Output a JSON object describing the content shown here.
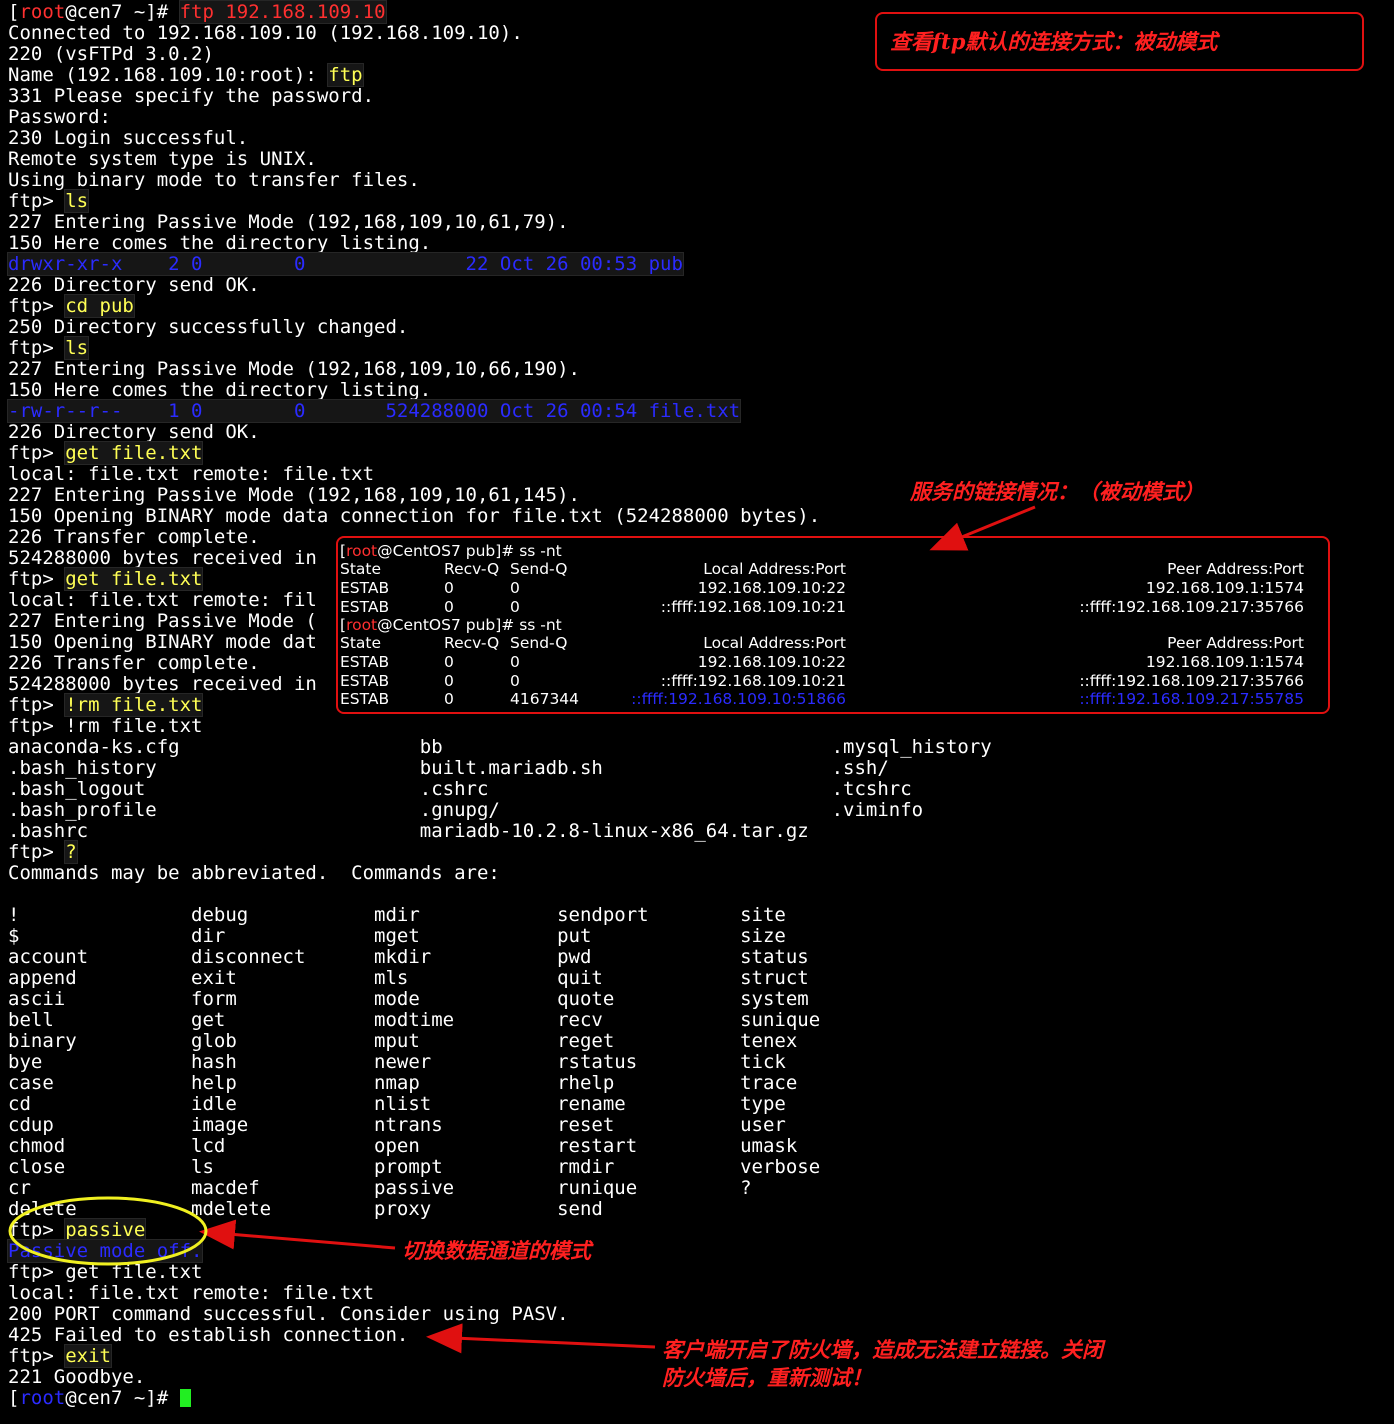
{
  "terminal": {
    "lines": [
      {
        "segments": [
          {
            "t": "[",
            "c": "w"
          },
          {
            "t": "root",
            "c": "r"
          },
          {
            "t": "@cen7 ~]# ",
            "c": "w"
          },
          {
            "t": "ftp 192.168.109.10",
            "c": "r",
            "hl": true
          }
        ]
      },
      {
        "segments": [
          {
            "t": "Connected to 192.168.109.10 (192.168.109.10).",
            "c": "w"
          }
        ]
      },
      {
        "segments": [
          {
            "t": "220 (vsFTPd 3.0.2)",
            "c": "w"
          }
        ]
      },
      {
        "segments": [
          {
            "t": "Name (192.168.109.10:root): ",
            "c": "w"
          },
          {
            "t": "ftp",
            "c": "y",
            "hl": true
          }
        ]
      },
      {
        "segments": [
          {
            "t": "331 Please specify the password.",
            "c": "w"
          }
        ]
      },
      {
        "segments": [
          {
            "t": "Password:",
            "c": "w"
          }
        ]
      },
      {
        "segments": [
          {
            "t": "230 Login successful.",
            "c": "w"
          }
        ]
      },
      {
        "segments": [
          {
            "t": "Remote system type is UNIX.",
            "c": "w"
          }
        ]
      },
      {
        "segments": [
          {
            "t": "Using binary mode to transfer files.",
            "c": "w"
          }
        ]
      },
      {
        "segments": [
          {
            "t": "ftp> ",
            "c": "w"
          },
          {
            "t": "ls",
            "c": "y",
            "hl": true
          }
        ]
      },
      {
        "segments": [
          {
            "t": "227 Entering Passive Mode (192,168,109,10,61,79).",
            "c": "w"
          }
        ]
      },
      {
        "segments": [
          {
            "t": "150 Here comes the directory listing.",
            "c": "w"
          }
        ]
      },
      {
        "segments": [
          {
            "t": "drwxr-xr-x    2 0        0              22 Oct 26 00:53 pub",
            "c": "b",
            "hl": true
          }
        ]
      },
      {
        "segments": [
          {
            "t": "226 Directory send OK.",
            "c": "w"
          }
        ]
      },
      {
        "segments": [
          {
            "t": "ftp> ",
            "c": "w"
          },
          {
            "t": "cd pub",
            "c": "y",
            "hl": true
          }
        ]
      },
      {
        "segments": [
          {
            "t": "250 Directory successfully changed.",
            "c": "w"
          }
        ]
      },
      {
        "segments": [
          {
            "t": "ftp> ",
            "c": "w"
          },
          {
            "t": "ls",
            "c": "y",
            "hl": true
          }
        ]
      },
      {
        "segments": [
          {
            "t": "227 Entering Passive Mode (192,168,109,10,66,190).",
            "c": "w"
          }
        ]
      },
      {
        "segments": [
          {
            "t": "150 Here comes the directory listing.",
            "c": "w"
          }
        ]
      },
      {
        "segments": [
          {
            "t": "-rw-r--r--    1 0        0       524288000 Oct 26 00:54 file.txt",
            "c": "b",
            "hl": true
          }
        ]
      },
      {
        "segments": [
          {
            "t": "226 Directory send OK.",
            "c": "w"
          }
        ]
      },
      {
        "segments": [
          {
            "t": "ftp> ",
            "c": "w"
          },
          {
            "t": "get file.txt",
            "c": "y",
            "hl": true
          }
        ]
      },
      {
        "segments": [
          {
            "t": "local: file.txt remote: file.txt",
            "c": "w"
          }
        ]
      },
      {
        "segments": [
          {
            "t": "227 Entering Passive Mode (192,168,109,10,61,145).",
            "c": "w"
          }
        ]
      },
      {
        "segments": [
          {
            "t": "150 Opening BINARY mode data connection for file.txt (524288000 bytes).",
            "c": "w"
          }
        ]
      },
      {
        "segments": [
          {
            "t": "226 Transfer complete.",
            "c": "w"
          }
        ]
      },
      {
        "segments": [
          {
            "t": "524288000 bytes received in",
            "c": "w"
          }
        ]
      },
      {
        "segments": [
          {
            "t": "ftp> ",
            "c": "w"
          },
          {
            "t": "get file.txt",
            "c": "y",
            "hl": true
          }
        ]
      },
      {
        "segments": [
          {
            "t": "local: file.txt remote: fil",
            "c": "w"
          }
        ]
      },
      {
        "segments": [
          {
            "t": "227 Entering Passive Mode (",
            "c": "w"
          }
        ]
      },
      {
        "segments": [
          {
            "t": "150 Opening BINARY mode dat",
            "c": "w"
          }
        ]
      },
      {
        "segments": [
          {
            "t": "226 Transfer complete.",
            "c": "w"
          }
        ]
      },
      {
        "segments": [
          {
            "t": "524288000 bytes received in",
            "c": "w"
          }
        ]
      },
      {
        "segments": [
          {
            "t": "ftp> ",
            "c": "w"
          },
          {
            "t": "!rm file.txt",
            "c": "y",
            "hl": true
          }
        ]
      },
      {
        "segments": [
          {
            "t": "ftp> !rm file.txt",
            "c": "w"
          }
        ]
      },
      {
        "segments": [
          {
            "t": "anaconda-ks.cfg                     bb                                  .mysql_history",
            "c": "w"
          }
        ]
      },
      {
        "segments": [
          {
            "t": ".bash_history                       built.mariadb.sh                    .ssh/",
            "c": "w"
          }
        ]
      },
      {
        "segments": [
          {
            "t": ".bash_logout                        .cshrc                              .tcshrc",
            "c": "w"
          }
        ]
      },
      {
        "segments": [
          {
            "t": ".bash_profile                       .gnupg/                             .viminfo",
            "c": "w"
          }
        ]
      },
      {
        "segments": [
          {
            "t": ".bashrc                             mariadb-10.2.8-linux-x86_64.tar.gz",
            "c": "w"
          }
        ]
      },
      {
        "segments": [
          {
            "t": "ftp> ",
            "c": "w"
          },
          {
            "t": "?",
            "c": "y",
            "hl": true
          }
        ]
      },
      {
        "segments": [
          {
            "t": "Commands may be abbreviated.  Commands are:",
            "c": "w"
          }
        ]
      },
      {
        "segments": [
          {
            "t": "",
            "c": "w"
          }
        ]
      },
      {
        "segments": [
          {
            "t": "!               debug           mdir            sendport        site",
            "c": "w"
          }
        ]
      },
      {
        "segments": [
          {
            "t": "$               dir             mget            put             size",
            "c": "w"
          }
        ]
      },
      {
        "segments": [
          {
            "t": "account         disconnect      mkdir           pwd             status",
            "c": "w"
          }
        ]
      },
      {
        "segments": [
          {
            "t": "append          exit            mls             quit            struct",
            "c": "w"
          }
        ]
      },
      {
        "segments": [
          {
            "t": "ascii           form            mode            quote           system",
            "c": "w"
          }
        ]
      },
      {
        "segments": [
          {
            "t": "bell            get             modtime         recv            sunique",
            "c": "w"
          }
        ]
      },
      {
        "segments": [
          {
            "t": "binary          glob            mput            reget           tenex",
            "c": "w"
          }
        ]
      },
      {
        "segments": [
          {
            "t": "bye             hash            newer           rstatus         tick",
            "c": "w"
          }
        ]
      },
      {
        "segments": [
          {
            "t": "case            help            nmap            rhelp           trace",
            "c": "w"
          }
        ]
      },
      {
        "segments": [
          {
            "t": "cd              idle            nlist           rename          type",
            "c": "w"
          }
        ]
      },
      {
        "segments": [
          {
            "t": "cdup            image           ntrans          reset           user",
            "c": "w"
          }
        ]
      },
      {
        "segments": [
          {
            "t": "chmod           lcd             open            restart         umask",
            "c": "w"
          }
        ]
      },
      {
        "segments": [
          {
            "t": "close           ls              prompt          rmdir           verbose",
            "c": "w"
          }
        ]
      },
      {
        "segments": [
          {
            "t": "cr              macdef          passive         runique         ?",
            "c": "w"
          }
        ]
      },
      {
        "segments": [
          {
            "t": "delete          mdelete         proxy           send",
            "c": "w"
          }
        ]
      },
      {
        "segments": [
          {
            "t": "ftp> ",
            "c": "w"
          },
          {
            "t": "passive",
            "c": "y",
            "hl": true
          }
        ]
      },
      {
        "segments": [
          {
            "t": "Passive mode off.",
            "c": "b",
            "hl": true
          }
        ]
      },
      {
        "segments": [
          {
            "t": "ftp> get file.txt",
            "c": "w"
          }
        ]
      },
      {
        "segments": [
          {
            "t": "local: file.txt remote: file.txt",
            "c": "w"
          }
        ]
      },
      {
        "segments": [
          {
            "t": "200 PORT command successful. Consider using PASV.",
            "c": "w"
          }
        ]
      },
      {
        "segments": [
          {
            "t": "425 Failed to establish connection.",
            "c": "w"
          }
        ]
      },
      {
        "segments": [
          {
            "t": "ftp> ",
            "c": "w"
          },
          {
            "t": "exit",
            "c": "y",
            "hl": true
          }
        ]
      },
      {
        "segments": [
          {
            "t": "221 Goodbye.",
            "c": "w"
          }
        ]
      },
      {
        "segments": [
          {
            "t": "[",
            "c": "w"
          },
          {
            "t": "root",
            "c": "b"
          },
          {
            "t": "@cen7 ~]# ",
            "c": "w"
          }
        ],
        "cursor": true
      }
    ]
  },
  "ss_inset": {
    "prompt1": {
      "pre": "[",
      "user": "root",
      "post": "@CentOS7 pub]# ss -nt"
    },
    "prompt2": {
      "pre": "[",
      "user": "root",
      "post": "@CentOS7 pub]# ss -nt"
    },
    "header": {
      "state": "State",
      "recvq": "Recv-Q",
      "sendq": "Send-Q",
      "local": "Local Address:Port",
      "peer": "Peer Address:Port"
    },
    "block1": [
      {
        "state": "ESTAB",
        "recvq": "0",
        "sendq": "0",
        "local": "192.168.109.10:22",
        "peer": "192.168.109.1:1574"
      },
      {
        "state": "ESTAB",
        "recvq": "0",
        "sendq": "0",
        "local": "::ffff:192.168.109.10:21",
        "peer": "::ffff:192.168.109.217:35766"
      }
    ],
    "block2": [
      {
        "state": "ESTAB",
        "recvq": "0",
        "sendq": "0",
        "local": "192.168.109.10:22",
        "peer": "192.168.109.1:1574"
      },
      {
        "state": "ESTAB",
        "recvq": "0",
        "sendq": "0",
        "local": "::ffff:192.168.109.10:21",
        "peer": "::ffff:192.168.109.217:35766"
      },
      {
        "state": "ESTAB",
        "recvq": "0",
        "sendq": "4167344",
        "local": "::ffff:192.168.109.10:51866",
        "peer": "::ffff:192.168.109.217:55785",
        "highlight": true
      }
    ]
  },
  "annotations": {
    "default_mode_note": "查看ftp默认的连接方式：被动模式",
    "service_note": "服务的链接情况：（被动模式）",
    "switch_note": "切换数据通道的模式",
    "firewall_note_1": "客户端开启了防火墙，造成无法建立链接。关闭",
    "firewall_note_2": "防火墙后，重新测试！"
  },
  "colors": {
    "terminal_bg": "#000000",
    "prompt_text": "#ffffff",
    "command": "#ffff55",
    "user_red": "#ff3030",
    "listing_blue": "#2b2bff",
    "annotation": "#ff2020",
    "cursor": "#22ee22"
  }
}
